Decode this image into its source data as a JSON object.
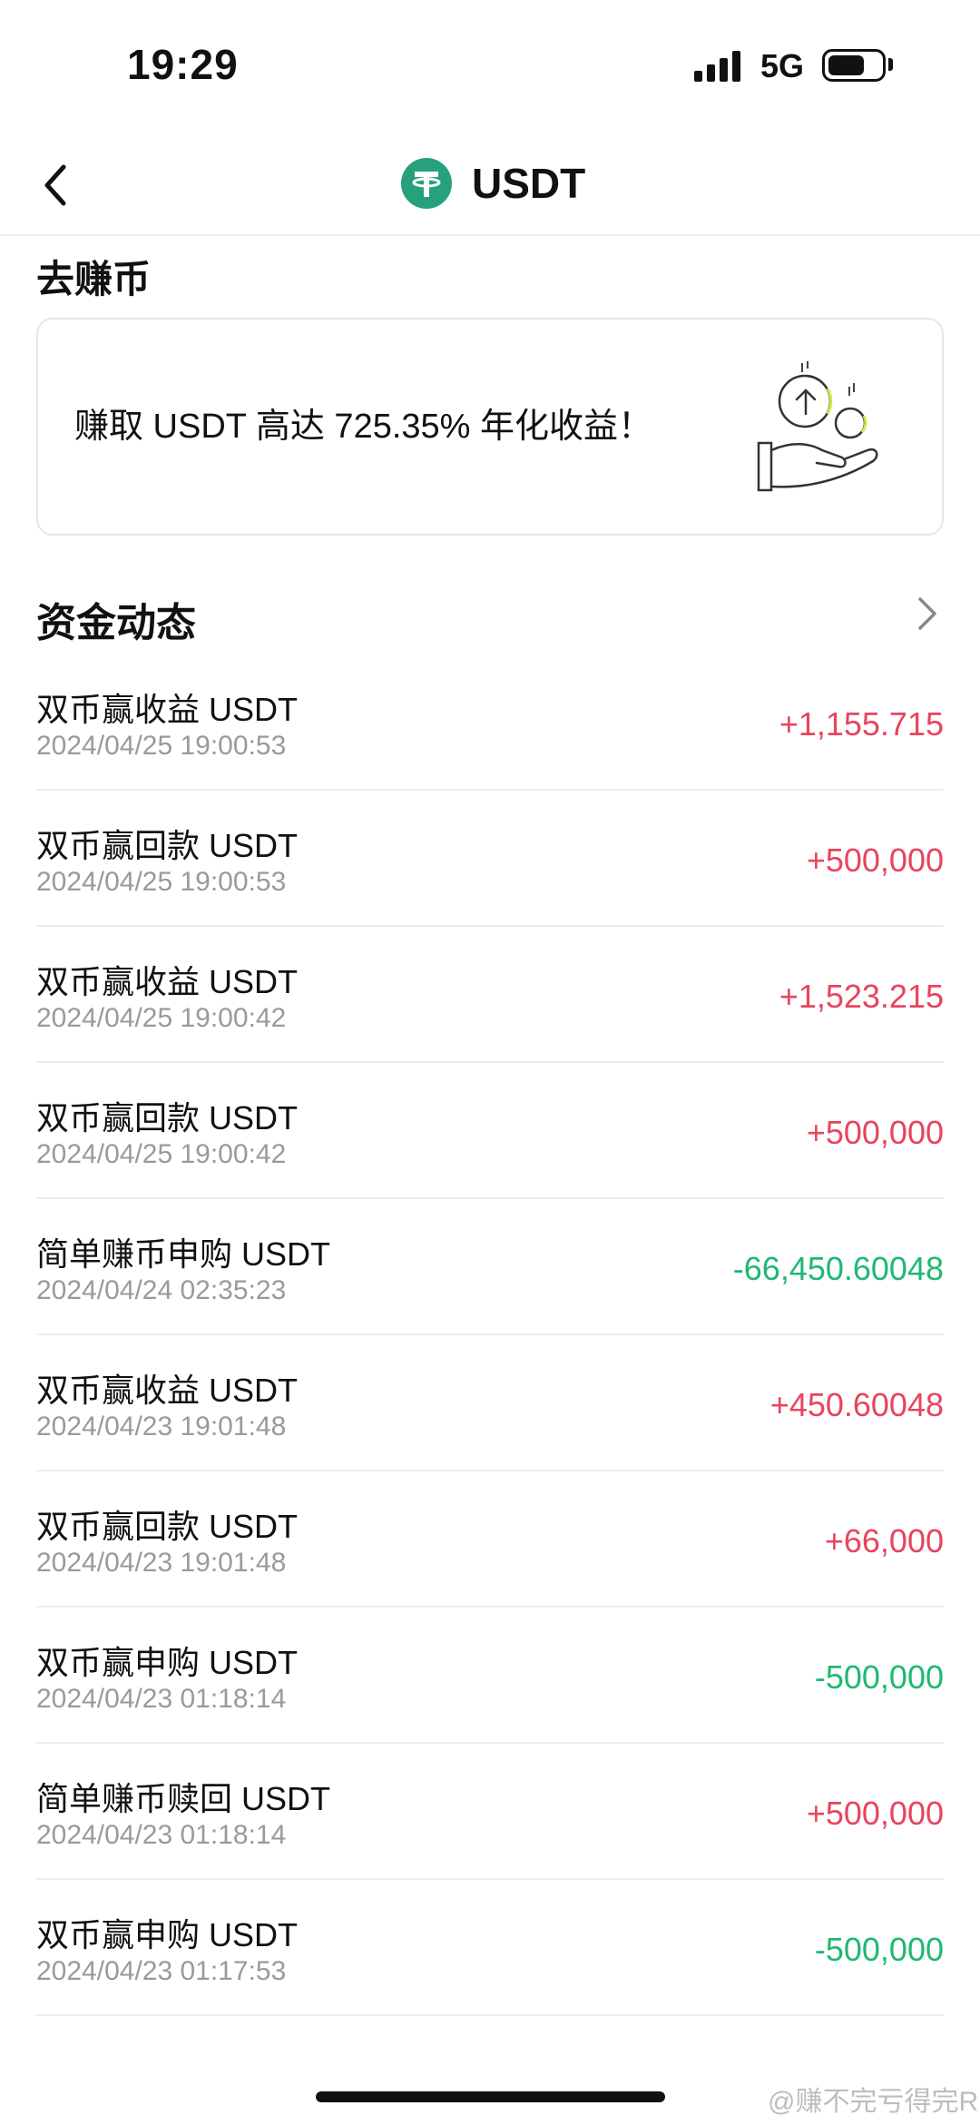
{
  "status": {
    "time": "19:29",
    "network": "5G",
    "battery_level": 0.7
  },
  "header": {
    "title": "USDT",
    "back_icon": "chevron-left-icon",
    "coin_icon": "tether-logo-icon",
    "coin_color": "#26a17b"
  },
  "earn": {
    "section_title": "去赚币",
    "promo_text": "赚取 USDT 高达 725.35% 年化收益！",
    "illustration": "coins-in-hand-icon"
  },
  "funds": {
    "section_title": "资金动态",
    "more_icon": "chevron-right-icon",
    "positive_color": "#e8445e",
    "negative_color": "#1fb872",
    "transactions": [
      {
        "title": "双币赢收益 USDT",
        "time": "2024/04/25 19:00:53",
        "amount": "+1,155.715",
        "direction": "in"
      },
      {
        "title": "双币赢回款 USDT",
        "time": "2024/04/25 19:00:53",
        "amount": "+500,000",
        "direction": "in"
      },
      {
        "title": "双币赢收益 USDT",
        "time": "2024/04/25 19:00:42",
        "amount": "+1,523.215",
        "direction": "in"
      },
      {
        "title": "双币赢回款 USDT",
        "time": "2024/04/25 19:00:42",
        "amount": "+500,000",
        "direction": "in"
      },
      {
        "title": "简单赚币申购 USDT",
        "time": "2024/04/24 02:35:23",
        "amount": "-66,450.60048",
        "direction": "out"
      },
      {
        "title": "双币赢收益 USDT",
        "time": "2024/04/23 19:01:48",
        "amount": "+450.60048",
        "direction": "in"
      },
      {
        "title": "双币赢回款 USDT",
        "time": "2024/04/23 19:01:48",
        "amount": "+66,000",
        "direction": "in"
      },
      {
        "title": "双币赢申购 USDT",
        "time": "2024/04/23 01:18:14",
        "amount": "-500,000",
        "direction": "out"
      },
      {
        "title": "简单赚币赎回 USDT",
        "time": "2024/04/23 01:18:14",
        "amount": "+500,000",
        "direction": "in"
      },
      {
        "title": "双币赢申购 USDT",
        "time": "2024/04/23 01:17:53",
        "amount": "-500,000",
        "direction": "out"
      }
    ]
  },
  "watermark": "@赚不完亏得完R"
}
